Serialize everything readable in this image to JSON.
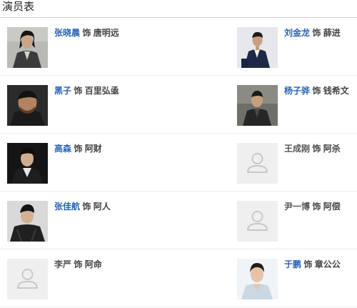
{
  "section_title": "演员表",
  "cast": [
    {
      "actor": "张晓晨",
      "as": "饰",
      "role": "唐明远",
      "linked": true,
      "photo": "portrait"
    },
    {
      "actor": "刘金龙",
      "as": "饰",
      "role": "薛进",
      "linked": true,
      "photo": "portrait"
    },
    {
      "actor": "黑子",
      "as": "饰",
      "role": "百里弘亟",
      "linked": true,
      "photo": "portrait"
    },
    {
      "actor": "杨子骅",
      "as": "饰",
      "role": "钱希文",
      "linked": true,
      "photo": "portrait"
    },
    {
      "actor": "高森",
      "as": "饰",
      "role": "阿财",
      "linked": true,
      "photo": "portrait"
    },
    {
      "actor": "王成刚",
      "as": "饰",
      "role": "阿杀",
      "linked": false,
      "photo": "placeholder"
    },
    {
      "actor": "张佳航",
      "as": "饰",
      "role": "阿人",
      "linked": true,
      "photo": "portrait"
    },
    {
      "actor": "尹一博",
      "as": "饰",
      "role": "阿偿",
      "linked": false,
      "photo": "placeholder"
    },
    {
      "actor": "李严",
      "as": "饰",
      "role": "阿命",
      "linked": false,
      "photo": "placeholder"
    },
    {
      "actor": "于鹏",
      "as": "饰",
      "role": "章公公",
      "linked": true,
      "photo": "portrait"
    }
  ],
  "colors": {
    "link": "#2a64b4",
    "text": "#444444",
    "divider": "#eeeeee"
  }
}
